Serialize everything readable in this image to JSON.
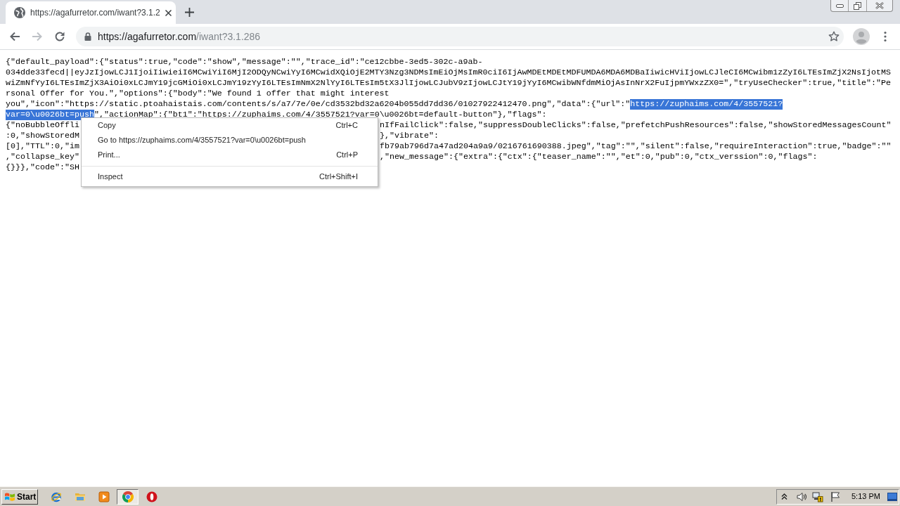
{
  "browser": {
    "tabs": [
      {
        "title": "https://agafurretor.com/iwant?3.1.2",
        "selected": true
      }
    ],
    "nav_buttons": [
      {
        "kind": "back",
        "disabled": false
      },
      {
        "kind": "forward",
        "disabled": true
      },
      {
        "kind": "reload",
        "disabled": false
      }
    ],
    "address_bar": {
      "host": "https://agafurretor.com",
      "path": "/iwant?3.1.286"
    }
  },
  "page": {
    "lines": [
      {
        "parts": [
          {
            "text": "{\"default_payload\":{\"status\":true,\"code\":\"show\",\"message\":\"\",\"trace_id\":\"ce12cbbe-3ed5-302c-a9ab-",
            "selected": false
          }
        ]
      },
      {
        "parts": [
          {
            "text": "034dde33fecd||eyJzIjowLCJ1IjoiIiwieiI6MCwiYiI6MjI2ODQyNCwiYyI6MCwidXQiOjE2MTY3Nzg3NDMsImEiOjMsImR0ciI6IjAwMDEtMDEtMDFUMDA6MDA6MDBaIiwicHViIjowLCJleCI6MCwibm1zZyI6LTEsImZjX2NsIjotMS",
            "selected": false
          }
        ]
      },
      {
        "parts": [
          {
            "text": "wiZmNfYyI6LTEsImZjX3AiOi0xLCJmY19jcGMiOi0xLCJmY19zYyI6LTEsImNmX2NlYyI6LTEsIm5tX3JlIjowLCJubV9zIjowLCJtY19jYyI6MCwibWNfdmMiOjAsInNrX2FuIjpmYWxzZX0=\",\"tryUseChecker\":true,\"title\":\"Pe",
            "selected": false
          }
        ]
      },
      {
        "parts": [
          {
            "text": "rsonal Offer for You.\",\"options\":{\"body\":\"We found 1 offer that might interest",
            "selected": false
          }
        ]
      },
      {
        "parts": [
          {
            "text": "you\",\"icon\":\"https://static.ptoahaistais.com/contents/s/a7/7e/0e/cd3532bd32a6204b055dd7dd36/01027922412470.png\",\"data\":{\"url\":\"",
            "selected": false
          },
          {
            "text": "https://zuphaims.com/4/3557521?",
            "selected": true
          }
        ]
      },
      {
        "parts": [
          {
            "text": "var=0\\u0026bt=push",
            "selected": true
          },
          {
            "text": "\",\"actionMap\":{\"bt1\":\"https://zuphaims.com/4/3557521?var=0\\u0026bt=default-button\"},\"flags\":",
            "selected": false
          }
        ]
      },
      {
        "parts": [
          {
            "text": "{\"noBubbleOffli",
            "selected": false
          }
        ],
        "after_menu": [
          {
            "text": "nIfFailClick\":false,\"suppressDoubleClicks\":false,\"prefetchPushResources\":false,\"showStoredMessagesCount\"",
            "selected": false
          }
        ]
      },
      {
        "parts": [
          {
            "text": ":0,\"showStoredM",
            "selected": false
          }
        ],
        "after_menu": [
          {
            "text": "},\"vibrate\":",
            "selected": false
          }
        ]
      },
      {
        "parts": [
          {
            "text": "[0],\"TTL\":0,\"im",
            "selected": false
          }
        ],
        "after_menu": [
          {
            "text": "fb79ab796d7a47ad204a9a9/0216761690388.jpeg\",\"tag\":\"\",\"silent\":false,\"requireInteraction\":true,\"badge\":\"\"",
            "selected": false
          }
        ]
      },
      {
        "parts": [
          {
            "text": ",\"collapse_key\"",
            "selected": false
          }
        ],
        "after_menu": [
          {
            "text": ",\"new_message\":{\"extra\":{\"ctx\":{\"teaser_name\":\"\",\"et\":0,\"pub\":0,\"ctx_verssion\":0,\"flags\":",
            "selected": false
          }
        ]
      },
      {
        "parts": [
          {
            "text": "{}}},\"code\":\"SH",
            "selected": false
          }
        ]
      }
    ]
  },
  "context_menu": {
    "items": [
      {
        "kind": "item",
        "label": "Copy",
        "shortcut": "Ctrl+C"
      },
      {
        "kind": "item",
        "label": "Go to https://zuphaims.com/4/3557521?var=0\\u0026bt=push"
      },
      {
        "kind": "item",
        "label": "Print...",
        "shortcut": "Ctrl+P"
      },
      {
        "kind": "separator"
      },
      {
        "kind": "item",
        "label": "Inspect",
        "shortcut": "Ctrl+Shift+I"
      }
    ]
  },
  "taskbar": {
    "start": "Start",
    "apps": [
      {
        "kind": "e",
        "selected": false
      },
      {
        "kind": "folder",
        "selected": false
      },
      {
        "kind": "player",
        "selected": false
      },
      {
        "kind": "wheel",
        "selected": true
      },
      {
        "kind": "ring",
        "selected": false
      }
    ],
    "clock": "5:13 PM"
  }
}
